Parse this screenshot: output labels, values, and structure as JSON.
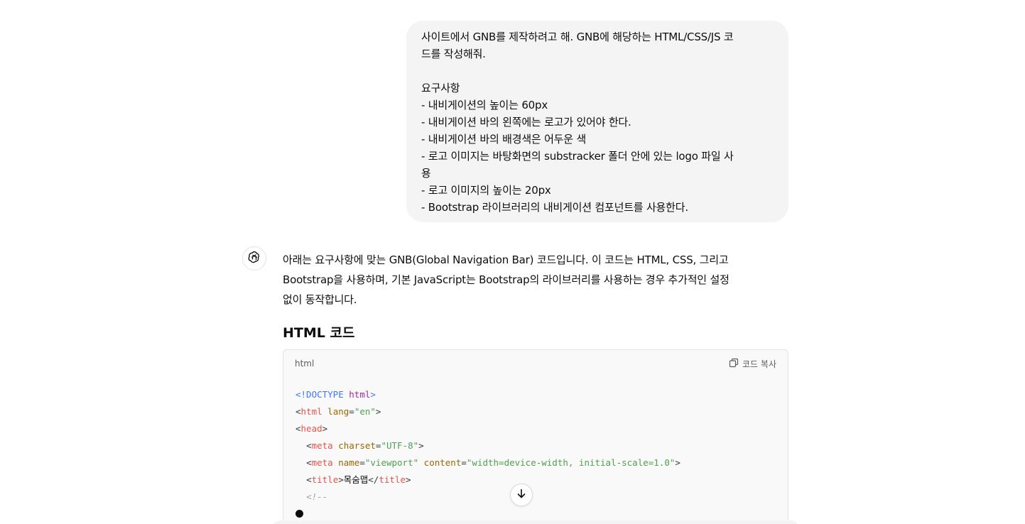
{
  "user_message": {
    "lines": [
      "사이트에서 GNB를 제작하려고 해. GNB에 해당하는 HTML/CSS/JS 코",
      "드를 작성해줘.",
      "",
      "요구사항",
      "- 내비게이션의 높이는 60px",
      "- 내비게이션 바의 왼쪽에는 로고가 있어야 한다.",
      "- 내비게이션 바의 배경색은 어두운 색",
      "- 로고 이미지는 바탕화면의 substracker 폴더 안에 있는 logo 파일 사",
      "용",
      "- 로고 이미지의 높이는 20px",
      "- Bootstrap 라이브러리의 내비게이션 컴포넌트를 사용한다."
    ]
  },
  "assistant": {
    "avatar_icon": "openai-logo-icon",
    "paragraph_lines": [
      "아래는 요구사항에 맞는 GNB(Global Navigation Bar) 코드입니다. 이 코드는 HTML, CSS, 그리고",
      "Bootstrap을 사용하며, 기본 JavaScript는 Bootstrap의 라이브러리를 사용하는 경우 추가적인 설정",
      "없이 동작합니다."
    ],
    "heading": "HTML 코드",
    "code_block": {
      "language": "html",
      "copy_label": "코드 복사",
      "copy_icon": "copy-icon",
      "lines": [
        {
          "indent": "",
          "tokens": [
            [
              "c-doctype",
              "<!DOCTYPE "
            ],
            [
              "c-kw",
              "html"
            ],
            [
              "c-doctype",
              ">"
            ]
          ]
        },
        {
          "indent": "",
          "tokens": [
            [
              "c-punct",
              "<"
            ],
            [
              "c-tag",
              "html"
            ],
            [
              "c-punct",
              " "
            ],
            [
              "c-attr",
              "lang"
            ],
            [
              "c-punct",
              "="
            ],
            [
              "c-str",
              "\"en\""
            ],
            [
              "c-punct",
              ">"
            ]
          ]
        },
        {
          "indent": "",
          "tokens": [
            [
              "c-punct",
              "<"
            ],
            [
              "c-tag",
              "head"
            ],
            [
              "c-punct",
              ">"
            ]
          ]
        },
        {
          "indent": "  ",
          "tokens": [
            [
              "c-punct",
              "<"
            ],
            [
              "c-tag",
              "meta"
            ],
            [
              "c-punct",
              " "
            ],
            [
              "c-attr",
              "charset"
            ],
            [
              "c-punct",
              "="
            ],
            [
              "c-str",
              "\"UTF-8\""
            ],
            [
              "c-punct",
              ">"
            ]
          ]
        },
        {
          "indent": "  ",
          "tokens": [
            [
              "c-punct",
              "<"
            ],
            [
              "c-tag",
              "meta"
            ],
            [
              "c-punct",
              " "
            ],
            [
              "c-attr",
              "name"
            ],
            [
              "c-punct",
              "="
            ],
            [
              "c-str",
              "\"viewport\""
            ],
            [
              "c-punct",
              " "
            ],
            [
              "c-attr",
              "content"
            ],
            [
              "c-punct",
              "="
            ],
            [
              "c-str",
              "\"width=device-width, initial-scale=1.0\""
            ],
            [
              "c-punct",
              ">"
            ]
          ]
        },
        {
          "indent": "  ",
          "tokens": [
            [
              "c-punct",
              "<"
            ],
            [
              "c-tag",
              "title"
            ],
            [
              "c-punct",
              ">"
            ],
            [
              "c-text",
              "목숨맵"
            ],
            [
              "c-punct",
              "</"
            ],
            [
              "c-tag",
              "title"
            ],
            [
              "c-punct",
              ">"
            ]
          ]
        },
        {
          "indent": "  ",
          "tokens": [
            [
              "c-comment",
              "<!--"
            ]
          ]
        }
      ]
    }
  },
  "scroll_button_icon": "arrow-down-icon",
  "streaming_indicator": "typing-dot"
}
